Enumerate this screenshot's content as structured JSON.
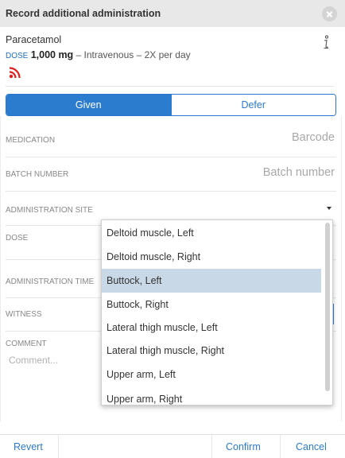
{
  "dialog": {
    "title": "Record additional administration"
  },
  "medication": {
    "name": "Paracetamol",
    "dose_label": "DOSE",
    "dose_value": "1,000 mg",
    "dose_details": " – Intravenous – 2X per day"
  },
  "tabs": {
    "given": "Given",
    "defer": "Defer",
    "selected": "Given"
  },
  "fields": {
    "medication_label": "MEDICATION",
    "medication_placeholder": "Barcode",
    "batch_label": "BATCH NUMBER",
    "batch_placeholder": "Batch number",
    "site_label": "ADMINISTRATION SITE",
    "dose_label": "DOSE",
    "time_label": "ADMINISTRATION TIME",
    "witness_label": "WITNESS",
    "comment_label": "COMMENT",
    "comment_placeholder": "Comment..."
  },
  "site_dropdown": {
    "options": [
      "Deltoid muscle, Left",
      "Deltoid muscle, Right",
      "Buttock, Left",
      "Buttock, Right",
      "Lateral thigh muscle, Left",
      "Lateral thigh muscle, Right",
      "Upper arm, Left",
      "Upper arm, Right"
    ],
    "highlighted": "Buttock, Left"
  },
  "footer": {
    "revert": "Revert",
    "confirm": "Confirm",
    "cancel": "Cancel"
  },
  "colors": {
    "accent": "#2b7bcf",
    "highlight": "#c8d8e6",
    "alert_icon": "#e0201e"
  },
  "icons": [
    "close-icon",
    "info-icon",
    "rss-alert-icon",
    "dropdown-caret-icon"
  ]
}
